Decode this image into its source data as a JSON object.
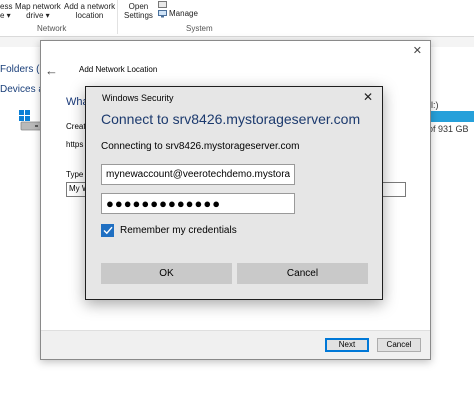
{
  "ribbon": {
    "items": [
      {
        "label": "ess",
        "label2": "e ▾"
      },
      {
        "label": "Map network",
        "label2": "drive ▾"
      },
      {
        "label": "Add a network",
        "label2": "location"
      },
      {
        "label": "Open",
        "label2": "Settings"
      },
      {
        "label": "Manage"
      }
    ],
    "groups": {
      "network": "Network",
      "system": "System"
    }
  },
  "explorer": {
    "folders_label": "Folders (7",
    "devices_label": "Devices an",
    "right_text_1": "l:)",
    "right_text_2": "of 931 GB",
    "capacity_bar_color": "#26a0da"
  },
  "wizard": {
    "title": "Add Network Location",
    "heading": "Wha",
    "text_1": "Creat",
    "text_2": "https",
    "type_label": "Type",
    "input_value": "My W",
    "next_label": "Next",
    "cancel_label": "Cancel"
  },
  "security": {
    "caption": "Windows Security",
    "title": "Connect to srv8426.mystorageserver.com",
    "subtitle": "Connecting to srv8426.mystorageserver.com",
    "username_value": "mynewaccount@veerotechdemo.mystorag",
    "password_value": "●●●●●●●●●●●●●",
    "remember_label": "Remember my credentials",
    "remember_checked": true,
    "ok_label": "OK",
    "cancel_label": "Cancel",
    "accent_color": "#1f6fc2"
  }
}
